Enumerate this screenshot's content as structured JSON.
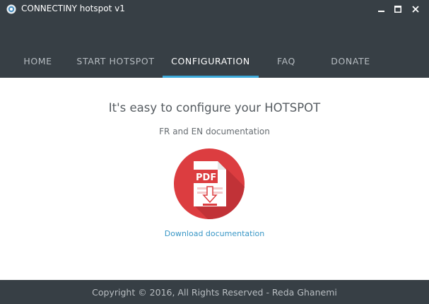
{
  "window": {
    "title": "CONNECTINY hotspot v1",
    "icon": "app-logo-icon"
  },
  "nav": {
    "items": [
      {
        "label": "HOME"
      },
      {
        "label": "START HOTSPOT"
      },
      {
        "label": "CONFIGURATION"
      },
      {
        "label": "FAQ"
      },
      {
        "label": "DONATE"
      }
    ],
    "active_index": 2
  },
  "content": {
    "heading": "It's easy to configure your HOTSPOT",
    "subheading": "FR and EN documentation",
    "pdf_icon_label": "PDF",
    "download_label": "Download documentation"
  },
  "footer": {
    "text": "Copyright © 2016, All Rights Reserved - Reda Ghanemi"
  },
  "colors": {
    "chrome": "#373f45",
    "accent": "#3ca9d9",
    "pdf_red": "#dc3d40",
    "link": "#3a97c6"
  }
}
